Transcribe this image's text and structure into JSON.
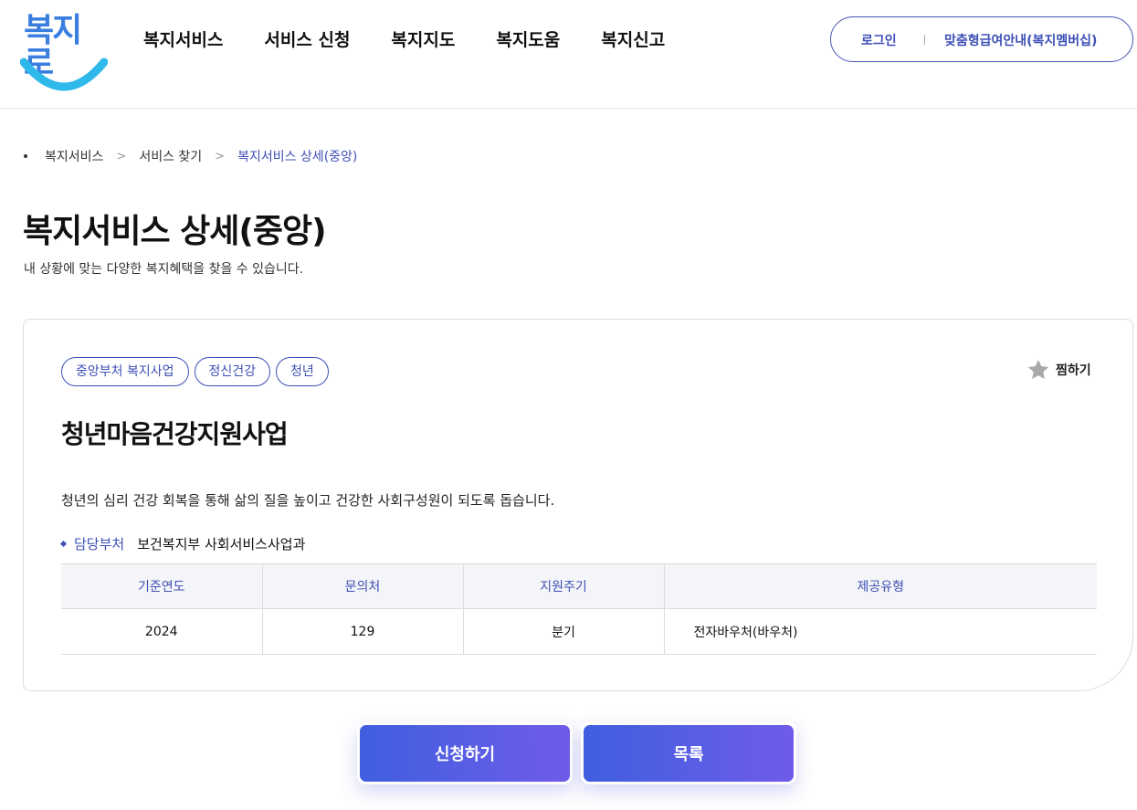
{
  "header": {
    "logo_text": "복지로",
    "nav": [
      "복지서비스",
      "서비스 신청",
      "복지지도",
      "복지도움",
      "복지신고"
    ],
    "login_label": "로그인",
    "member_label": "맞춤형급여안내(복지멤버십)"
  },
  "breadcrumb": [
    "복지서비스",
    "서비스 찾기",
    "복지서비스 상세(중앙)"
  ],
  "page": {
    "title": "복지서비스 상세(중앙)",
    "description": "내 상황에 맞는 다양한 복지혜택을 찾을 수 있습니다."
  },
  "service": {
    "tags": [
      "중앙부처 복지사업",
      "정신건강",
      "청년"
    ],
    "favorite_label": "찜하기",
    "title": "청년마음건강지원사업",
    "description": "청년의 심리 건강 회복을 통해 삶의 질을 높이고 건강한 사회구성원이 되도록 돕습니다.",
    "department_label": "담당부처",
    "department_value": "보건복지부 사회서비스사업과",
    "table": {
      "headers": [
        "기준연도",
        "문의처",
        "지원주기",
        "제공유형"
      ],
      "row": [
        "2024",
        "129",
        "분기",
        "전자바우처(바우처)"
      ]
    }
  },
  "buttons": {
    "apply": "신청하기",
    "list": "목록"
  },
  "colors": {
    "accent": "#3d4fb5",
    "logo": "#3a7ee0",
    "button_gradient_start": "#3f5fe0",
    "button_gradient_end": "#6f5ce8"
  }
}
